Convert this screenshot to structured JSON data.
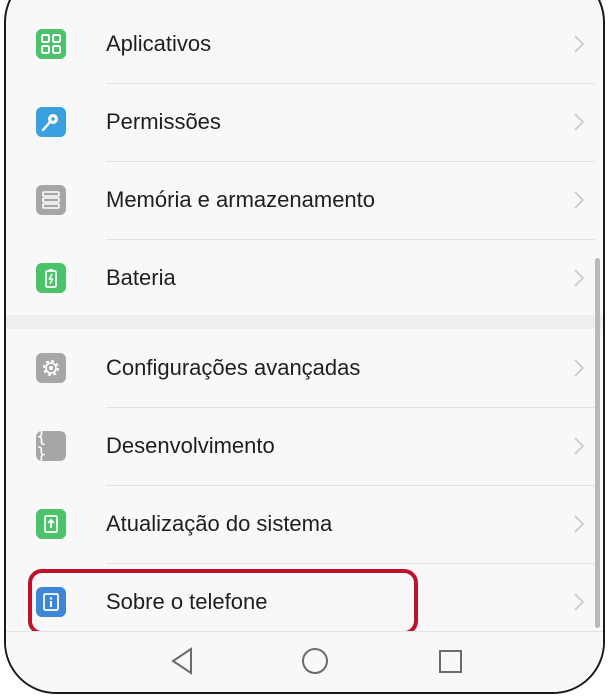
{
  "menu": {
    "items": [
      {
        "label": "Aplicativos",
        "icon": "apps-grid-icon",
        "color": "#4cc36b"
      },
      {
        "label": "Permissões",
        "icon": "key-icon",
        "color": "#3aa0e0"
      },
      {
        "label": "Memória e armazenamento",
        "icon": "storage-icon",
        "color": "#a6a6a6"
      },
      {
        "label": "Bateria",
        "icon": "battery-icon",
        "color": "#4cc36b"
      },
      {
        "label": "Configurações avançadas",
        "icon": "gear-icon",
        "color": "#a6a6a6"
      },
      {
        "label": "Desenvolvimento",
        "icon": "braces-icon",
        "color": "#a6a6a6"
      },
      {
        "label": "Atualização do sistema",
        "icon": "system-update-icon",
        "color": "#4cc36b"
      },
      {
        "label": "Sobre o telefone",
        "icon": "info-icon",
        "color": "#3d86d8"
      }
    ]
  },
  "navbar": {
    "back": "back-triangle-icon",
    "home": "home-circle-icon",
    "recents": "recents-square-icon"
  },
  "highlight_color": "#c0102c"
}
